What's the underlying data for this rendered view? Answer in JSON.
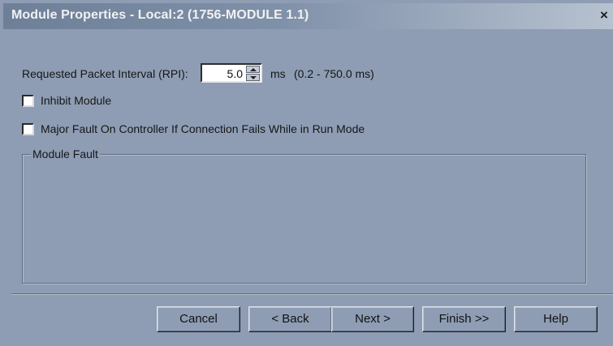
{
  "window": {
    "title": "Module Properties - Local:2 (1756-MODULE 1.1)",
    "close_symbol": "×"
  },
  "rpi": {
    "label": "Requested Packet Interval (RPI):",
    "value": "5.0",
    "unit": "ms",
    "range": "(0.2 - 750.0 ms)"
  },
  "options": {
    "inhibit_module": {
      "label": "Inhibit Module",
      "checked": false
    },
    "major_fault": {
      "label": "Major Fault On Controller If Connection Fails While in Run Mode",
      "checked": false
    }
  },
  "module_fault": {
    "legend": "Module Fault"
  },
  "buttons": {
    "cancel": "Cancel",
    "back": "< Back",
    "next": "Next >",
    "finish": "Finish >>",
    "help": "Help"
  },
  "colors": {
    "dialog_background": "#8e9db4",
    "title_text": "#f1f1f1"
  }
}
